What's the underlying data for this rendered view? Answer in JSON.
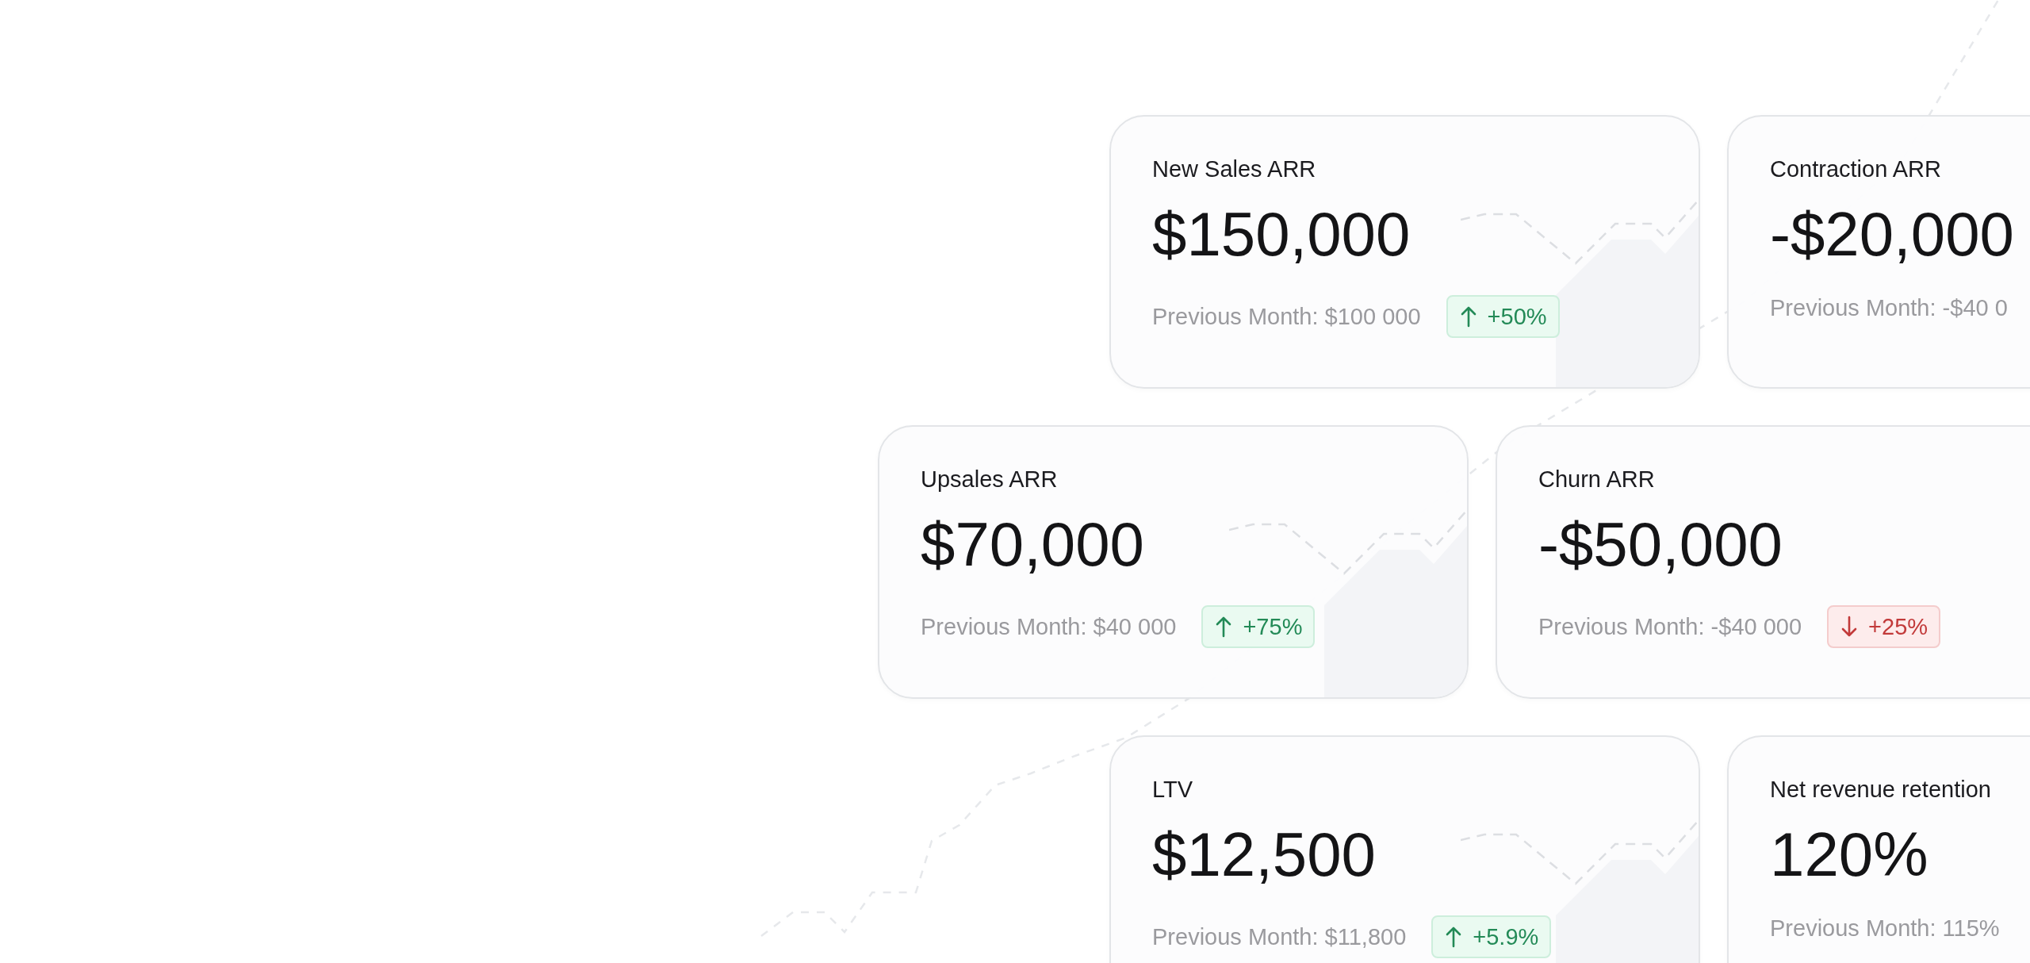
{
  "rows": [
    {
      "cards": [
        {
          "title": "New Sales ARR",
          "value": "$150,000",
          "previous": "Previous Month: $100 000",
          "badge": {
            "kind": "up",
            "text": "+50%"
          }
        },
        {
          "title": "Contraction ARR",
          "value": "-$20,000",
          "previous": "Previous Month: -$40 0"
        }
      ]
    },
    {
      "cards": [
        {
          "title": "Upsales ARR",
          "value": "$70,000",
          "previous": "Previous Month: $40 000",
          "badge": {
            "kind": "up",
            "text": "+75%"
          }
        },
        {
          "title": "Churn ARR",
          "value": "-$50,000",
          "previous": "Previous Month: -$40 000",
          "badge": {
            "kind": "down",
            "text": "+25%"
          }
        }
      ]
    },
    {
      "cards": [
        {
          "title": "LTV",
          "value": "$12,500",
          "previous": "Previous Month: $11,800",
          "badge": {
            "kind": "up",
            "text": "+5.9%"
          }
        },
        {
          "title": "Net revenue retention",
          "value": "120%",
          "previous": "Previous Month: 115%"
        }
      ]
    }
  ]
}
